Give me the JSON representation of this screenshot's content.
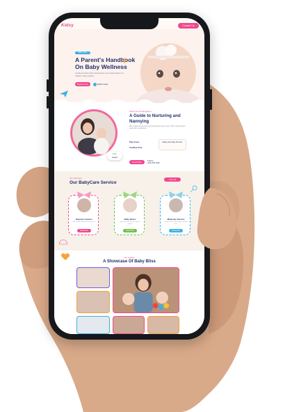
{
  "brand": {
    "logo_text": "Kidsy",
    "nav_button": "Contact Us"
  },
  "hero": {
    "tag": "Baby Care",
    "title_line1": "A Parent's Handbook",
    "title_line2": "On Baby Wellness",
    "description": "Guiding families with practical tips and trusted advice for healthy, happy babies.",
    "cta_button": "Explore Now",
    "play_label": "Watch Video"
  },
  "about": {
    "tag": "About Our Kindergarten",
    "title_line1": "A Guide to Nurturing and",
    "title_line2": "Nannying",
    "description": "We provide loving care and early learning for every child, helping them grow with confidence.",
    "features": [
      "Play Areas",
      "Certified Care"
    ],
    "feature_box": "Make your baby the best",
    "award_value": "100+",
    "award_label": "Award",
    "cta_button": "Read More",
    "call_label": "Call Us",
    "call_number": "(123) 456 7890"
  },
  "services": {
    "tag": "Our Services",
    "title": "Our BabyCare Service",
    "view_all": "View All",
    "cards": [
      {
        "name": "Daycare Centers",
        "desc": "Safe and fun daily care for little ones.",
        "button": "Read More",
        "color": "#f1488e"
      },
      {
        "name": "Baby Nurse",
        "desc": "Experienced nurses for newborn support.",
        "button": "Read More",
        "color": "#6cc04a"
      },
      {
        "name": "Maternity Service",
        "desc": "Caring help for moms before and after birth.",
        "button": "Read More",
        "color": "#3bb1e3"
      }
    ]
  },
  "gallery": {
    "tag": "Our Gallery",
    "title": "A Showcase Of Baby Bliss"
  },
  "colors": {
    "pink": "#f1488e",
    "navy": "#23306b",
    "blue": "#3bb1e3",
    "green": "#6cc04a",
    "orange": "#f7a23b"
  }
}
